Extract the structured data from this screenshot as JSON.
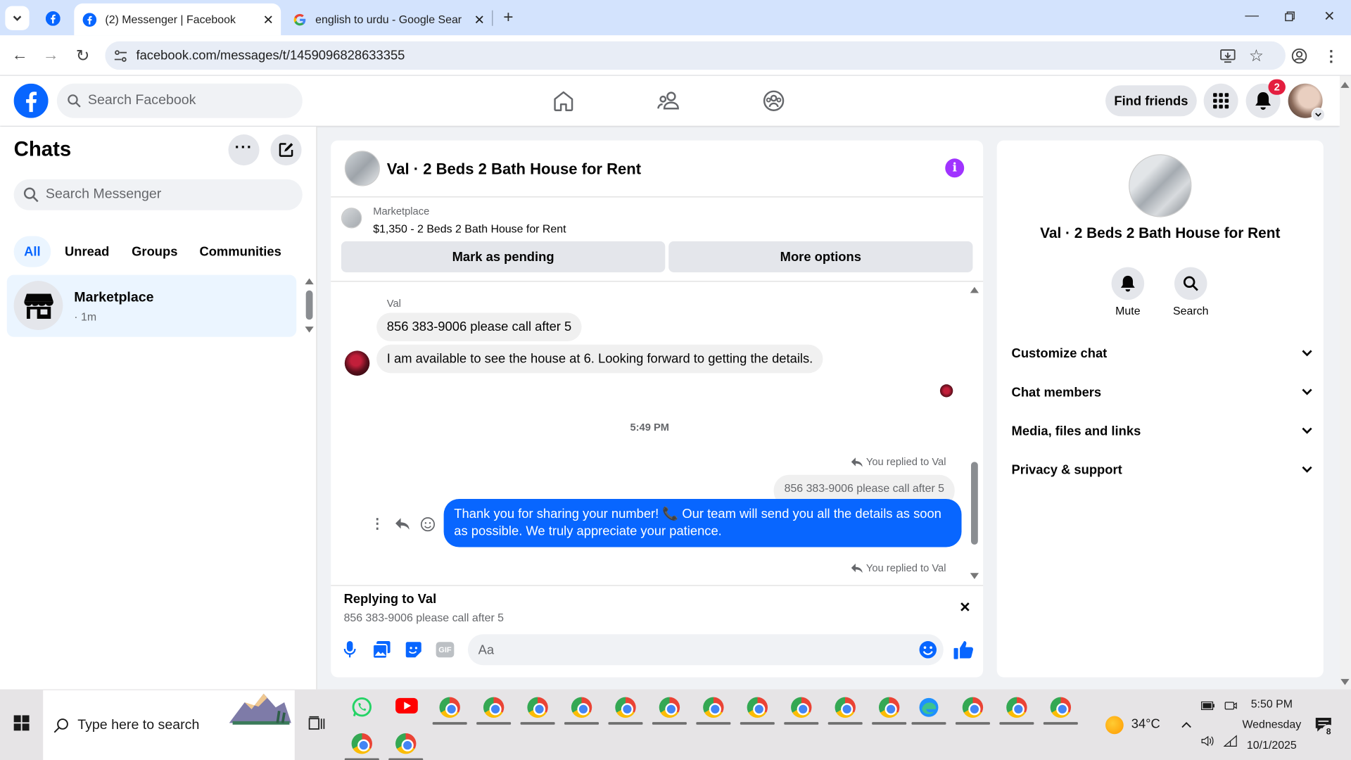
{
  "browser": {
    "tabs": [
      {
        "title": "(2) Messenger | Facebook"
      },
      {
        "title": "english to urdu - Google Search"
      }
    ],
    "url": "facebook.com/messages/t/1459096828633355"
  },
  "fb_header": {
    "search_placeholder": "Search Facebook",
    "find_friends": "Find friends",
    "notification_count": "2"
  },
  "chats_panel": {
    "title": "Chats",
    "search_placeholder": "Search Messenger",
    "filters": [
      "All",
      "Unread",
      "Groups",
      "Communities"
    ],
    "items": [
      {
        "name": "Marketplace",
        "time": "· 1m"
      }
    ]
  },
  "conversation": {
    "title": "Val · 2 Beds 2 Bath House for Rent",
    "listing_source": "Marketplace",
    "listing_title": "$1,350 - 2 Beds 2 Bath House for Rent",
    "mark_pending": "Mark as pending",
    "more_options": "More options",
    "sender_name": "Val",
    "messages": [
      {
        "text": "856 383-9006 please call after 5"
      },
      {
        "text": "I am available to see the house at 6. Looking forward to getting the details."
      }
    ],
    "timestamp": "5:49 PM",
    "replied_label": "You replied to Val",
    "quoted_text": "856 383-9006 please call after 5",
    "outgoing_text": "Thank you for sharing your number! 📞 Our team will send you all the details as soon as possible. We truly appreciate your patience.",
    "replied_label_2": "You replied to Val",
    "reply_bar_title": "Replying to Val",
    "reply_bar_quote": "856 383-9006 please call after 5",
    "composer_placeholder": "Aa",
    "accent_color": "#0866ff"
  },
  "info_panel": {
    "title": "Val · 2 Beds 2 Bath House for Rent",
    "mute_label": "Mute",
    "search_label": "Search",
    "sections": [
      "Customize chat",
      "Chat members",
      "Media, files and links",
      "Privacy & support"
    ]
  },
  "taskbar": {
    "search_placeholder": "Type here to search",
    "weather": "34°C",
    "time": "5:50 PM",
    "day": "Wednesday",
    "date": "10/1/2025",
    "notification_count": "8"
  }
}
